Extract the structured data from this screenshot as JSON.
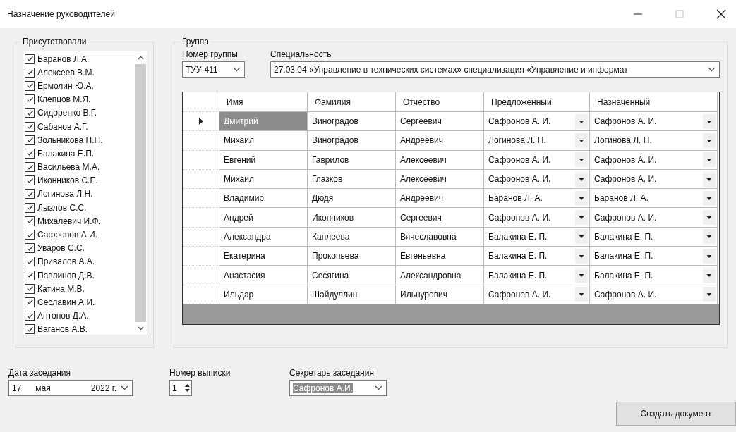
{
  "window": {
    "title": "Назначение руководителей"
  },
  "attendees": {
    "title": "Присутствовали",
    "items": [
      {
        "label": "Баранов Л.А.",
        "checked": true
      },
      {
        "label": "Алексеев В.М.",
        "checked": true
      },
      {
        "label": "Ермолин Ю.А.",
        "checked": true
      },
      {
        "label": "Клепцов М.Я.",
        "checked": true
      },
      {
        "label": "Сидоренко В.Г.",
        "checked": true
      },
      {
        "label": "Сабанов А.Г.",
        "checked": true
      },
      {
        "label": "Зольникова Н.Н.",
        "checked": true
      },
      {
        "label": "Балакина Е.П.",
        "checked": true
      },
      {
        "label": "Васильева М.А.",
        "checked": true
      },
      {
        "label": "Иконников С.Е.",
        "checked": true
      },
      {
        "label": "Логинова Л.Н.",
        "checked": true
      },
      {
        "label": "Лызлов С.С.",
        "checked": true
      },
      {
        "label": "Михалевич И.Ф.",
        "checked": true
      },
      {
        "label": "Сафронов А.И.",
        "checked": true
      },
      {
        "label": "Уваров С.С.",
        "checked": true
      },
      {
        "label": "Привалов А.А.",
        "checked": true
      },
      {
        "label": "Павлинов Д.В.",
        "checked": true
      },
      {
        "label": "Катина М.В.",
        "checked": true
      },
      {
        "label": "Сеславин А.И.",
        "checked": true
      },
      {
        "label": "Антонов Д.А.",
        "checked": true
      },
      {
        "label": "Ваганов А.В.",
        "checked": true
      }
    ]
  },
  "group": {
    "title": "Группа",
    "group_number": {
      "label": "Номер группы",
      "value": "ТУУ-411"
    },
    "specialty": {
      "label": "Специальность",
      "value": "27.03.04 «Управление в технических системах» специализация «Управление и информат"
    },
    "table": {
      "columns": [
        "Имя",
        "Фамилия",
        "Отчество",
        "Предложенный",
        "Назначенный"
      ],
      "rows": [
        {
          "selected": true,
          "cells": [
            "Дмитрий",
            "Виноградов",
            "Сергеевич",
            "Сафронов А. И.",
            "Сафронов А. И."
          ]
        },
        {
          "selected": false,
          "cells": [
            "Михаил",
            "Виноградов",
            "Андреевич",
            "Логинова Л. Н.",
            "Логинова Л. Н."
          ]
        },
        {
          "selected": false,
          "cells": [
            "Евгений",
            "Гаврилов",
            "Алексеевич",
            "Сафронов А. И.",
            "Сафронов А. И."
          ]
        },
        {
          "selected": false,
          "cells": [
            "Михаил",
            "Глазков",
            "Алексеевич",
            "Сафронов А. И.",
            "Сафронов А. И."
          ]
        },
        {
          "selected": false,
          "cells": [
            "Владимир",
            "Дюдя",
            "Андреевич",
            "Баранов Л. А.",
            "Баранов Л. А."
          ]
        },
        {
          "selected": false,
          "cells": [
            "Андрей",
            "Иконников",
            "Сергеевич",
            "Сафронов А. И.",
            "Сафронов А. И."
          ]
        },
        {
          "selected": false,
          "cells": [
            "Александра",
            "Каплеева",
            "Вячеславовна",
            "Балакина Е. П.",
            "Балакина Е. П."
          ]
        },
        {
          "selected": false,
          "cells": [
            "Екатерина",
            "Прокопьева",
            "Евгеньевна",
            "Балакина Е. П.",
            "Балакина Е. П."
          ]
        },
        {
          "selected": false,
          "cells": [
            "Анастасия",
            "Сесягина",
            "Александровна",
            "Балакина Е. П.",
            "Балакина Е. П."
          ]
        },
        {
          "selected": false,
          "cells": [
            "Ильдар",
            "Шайдуллин",
            "Ильнурович",
            "Сафронов А. И.",
            "Сафронов А. И."
          ]
        }
      ]
    }
  },
  "meeting_date": {
    "label": "Дата заседания",
    "day": "17",
    "month": "мая",
    "year": "2022 г."
  },
  "extract_number": {
    "label": "Номер выписки",
    "value": "1"
  },
  "secretary": {
    "label": "Секретарь заседания",
    "value": "Сафронов А.И.",
    "text_selected": true
  },
  "create_button": "Создать документ"
}
